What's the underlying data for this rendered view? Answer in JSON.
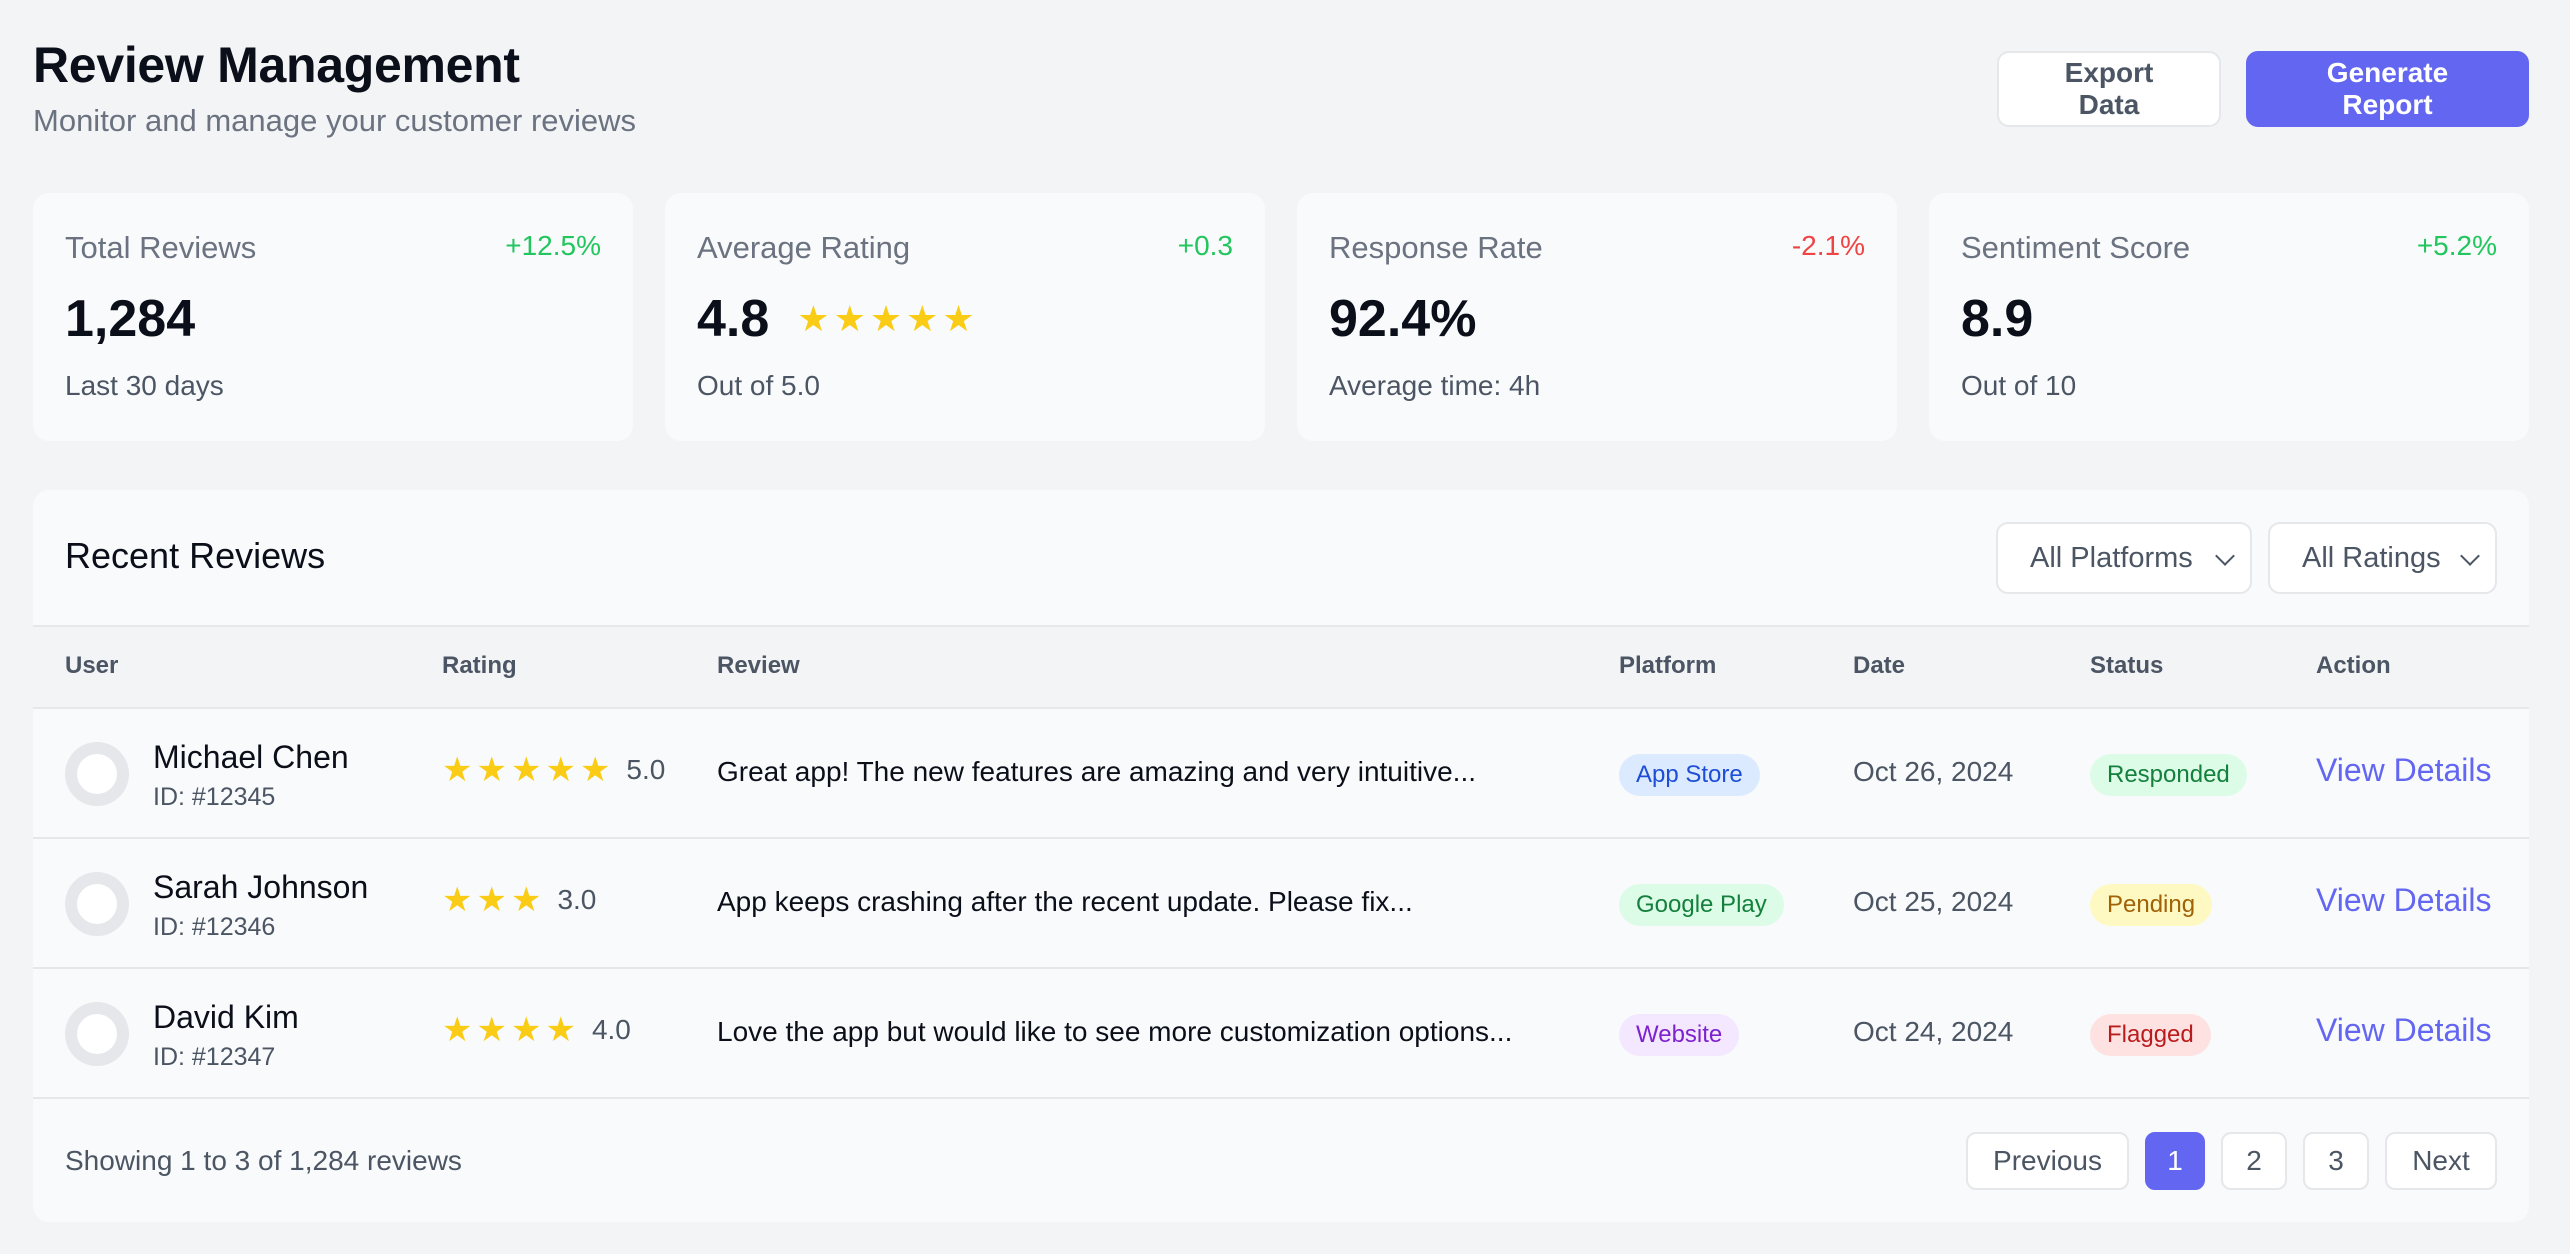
{
  "header": {
    "title": "Review Management",
    "subtitle": "Monitor and manage your customer reviews",
    "export_label": "Export Data",
    "generate_label": "Generate Report"
  },
  "stats": [
    {
      "label": "Total Reviews",
      "delta": "+12.5%",
      "value": "1,284",
      "note": "Last 30 days"
    },
    {
      "label": "Average Rating",
      "delta": "+0.3",
      "value": "4.8",
      "note": "Out of 5.0",
      "stars": 5
    },
    {
      "label": "Response Rate",
      "delta": "-2.1%",
      "value": "92.4%",
      "note": "Average time: 4h"
    },
    {
      "label": "Sentiment Score",
      "delta": "+5.2%",
      "value": "8.9",
      "note": "Out of 10"
    }
  ],
  "reviews_panel": {
    "title": "Recent Reviews",
    "platform_filter": "All Platforms",
    "rating_filter": "All Ratings",
    "columns": [
      "User",
      "Rating",
      "Review",
      "Platform",
      "Date",
      "Status",
      "Action"
    ],
    "rows": [
      {
        "name": "Michael Chen",
        "id": "ID: #12345",
        "stars": 5,
        "rating": "5.0",
        "review": "Great app! The new features are amazing and very intuitive...",
        "platform": "App Store",
        "date": "Oct 26, 2024",
        "status": "Responded",
        "action": "View Details"
      },
      {
        "name": "Sarah Johnson",
        "id": "ID: #12346",
        "stars": 3,
        "rating": "3.0",
        "review": "App keeps crashing after the recent update. Please fix...",
        "platform": "Google Play",
        "date": "Oct 25, 2024",
        "status": "Pending",
        "action": "View Details"
      },
      {
        "name": "David Kim",
        "id": "ID: #12347",
        "stars": 4,
        "rating": "4.0",
        "review": "Love the app but would like to see more customization options...",
        "platform": "Website",
        "date": "Oct 24, 2024",
        "status": "Flagged",
        "action": "View Details"
      }
    ],
    "showing": "Showing 1 to 3 of 1,284 reviews",
    "pagination": {
      "previous": "Previous",
      "pages": [
        "1",
        "2",
        "3"
      ],
      "current": "1",
      "next": "Next"
    }
  },
  "colors": {
    "accent": "#6366f1",
    "positive": "#22c55e",
    "negative": "#ef4444",
    "star": "#facc15",
    "app_store_bg": "#dbeafe",
    "app_store_fg": "#1d4ed8",
    "google_play_bg": "#dcfce7",
    "google_play_fg": "#15803d",
    "website_bg": "#f3e8ff",
    "website_fg": "#7e22ce",
    "responded_bg": "#dcfce7",
    "responded_fg": "#15803d",
    "pending_bg": "#fef9c3",
    "pending_fg": "#a16207",
    "flagged_bg": "#fee2e2",
    "flagged_fg": "#b91c1c"
  }
}
